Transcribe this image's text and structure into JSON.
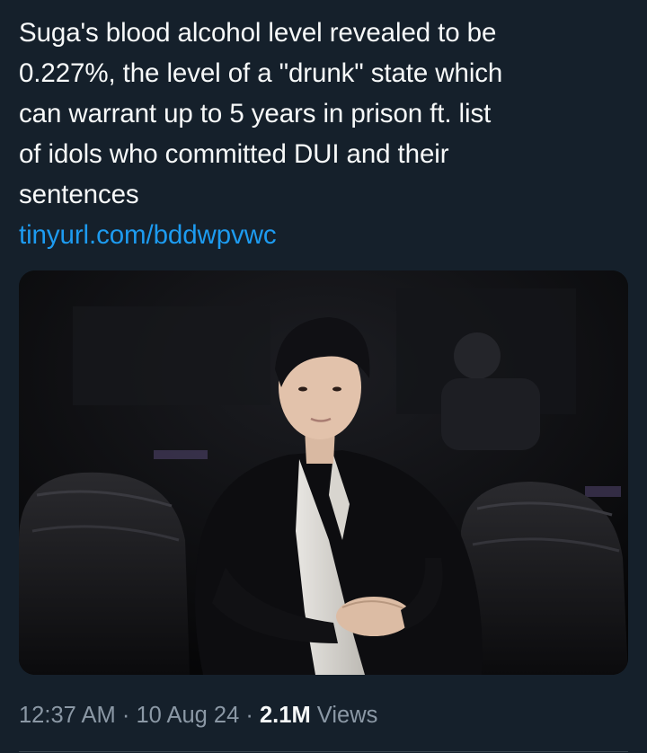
{
  "tweet": {
    "text_lines": [
      "Suga's blood alcohol level revealed to be",
      "0.227%, the level of a \"drunk\" state which",
      "can warrant up to 5 years in prison ft. list",
      "of idols who committed DUI and their",
      "sentences"
    ],
    "link": "tinyurl.com/bddwpvwc",
    "media": {
      "description_icon": "photo-image"
    },
    "meta": {
      "time": "12:37 AM",
      "separator": "·",
      "date": "10 Aug 24",
      "views_count": "2.1M",
      "views_label": "Views"
    }
  },
  "colors": {
    "background": "#15202b",
    "text": "#f7f9f9",
    "link": "#1d9bf0",
    "muted": "#8b98a5",
    "divider": "#38444d"
  }
}
